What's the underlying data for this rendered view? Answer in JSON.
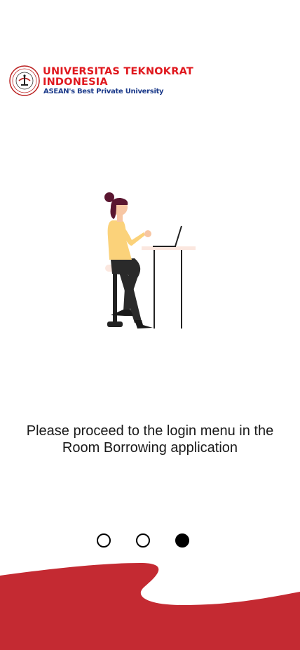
{
  "logo": {
    "line1": "UNIVERSITAS TEKNOKRAT",
    "line2": "INDONESIA",
    "tagline": "ASEAN's Best Private University",
    "color_primary": "#e0181e",
    "color_tagline": "#1b3a8a"
  },
  "illustration": {
    "icon": "woman-working-on-laptop-illustration"
  },
  "onboarding": {
    "message": "Please proceed to the login menu in the Room Borrowing application",
    "page_count": 3,
    "active_page": 3
  },
  "colors": {
    "accent": "#c42a32",
    "background": "#ffffff"
  }
}
